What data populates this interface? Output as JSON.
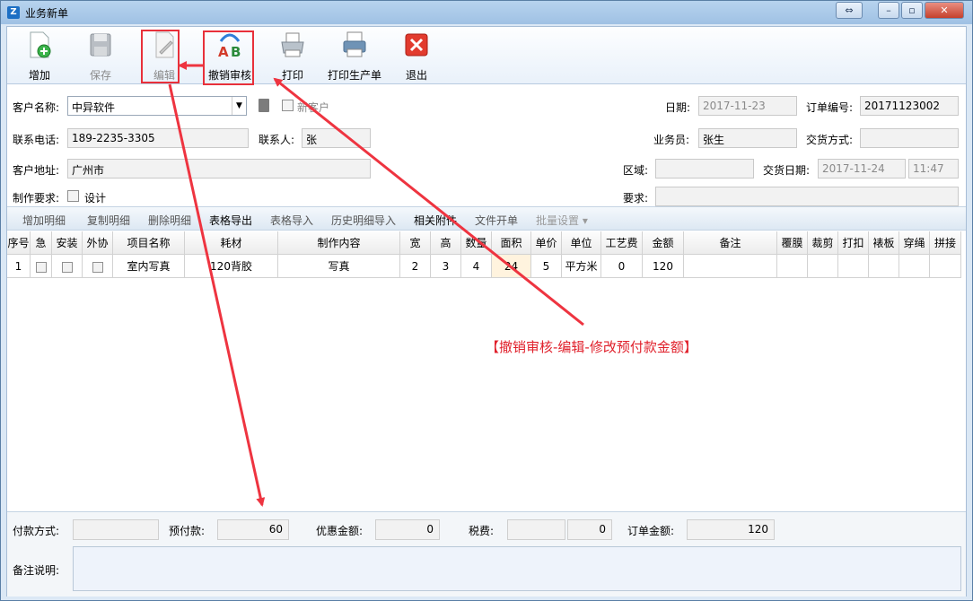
{
  "window": {
    "title": "业务新单"
  },
  "toolbar": {
    "add": "增加",
    "save": "保存",
    "edit": "编辑",
    "unaudit": "撤销审核",
    "print": "打印",
    "print_production": "打印生产单",
    "exit": "退出"
  },
  "form": {
    "customer_label": "客户名称:",
    "customer_value": "中异软件",
    "new_customer_label": "新客户",
    "date_label": "日期:",
    "date_value": "2017-11-23",
    "order_no_label": "订单编号:",
    "order_no_value": "20171123002",
    "phone_label": "联系电话:",
    "phone_value": "189-2235-3305",
    "contact_label": "联系人:",
    "contact_value": "张",
    "salesman_label": "业务员:",
    "salesman_value": "张生",
    "delivery_method_label": "交货方式:",
    "delivery_method_value": "",
    "address_label": "客户地址:",
    "address_value": "广州市",
    "region_label": "区域:",
    "region_value": "",
    "delivery_date_label": "交货日期:",
    "delivery_date_value": "2017-11-24",
    "delivery_time_value": "11:47",
    "requirement_label": "制作要求:",
    "design_label": "设计",
    "request_label": "要求:",
    "request_value": ""
  },
  "subtoolbar": [
    "增加明细",
    "复制明细",
    "删除明细",
    "表格导出",
    "表格导入",
    "历史明细导入",
    "相关附件",
    "文件开单",
    "批量设置"
  ],
  "table": {
    "headers": [
      "序号",
      "急",
      "安装",
      "外协",
      "项目名称",
      "耗材",
      "制作内容",
      "宽",
      "高",
      "数量",
      "面积",
      "单价",
      "单位",
      "工艺费",
      "金额",
      "备注",
      "覆膜",
      "裁剪",
      "打扣",
      "裱板",
      "穿绳",
      "拼接"
    ],
    "rows": [
      [
        "1",
        "",
        "",
        "",
        "室内写真",
        "120背胶",
        "写真",
        "2",
        "3",
        "4",
        "24",
        "5",
        "平方米",
        "0",
        "120",
        "",
        "",
        "",
        "",
        "",
        "",
        ""
      ]
    ]
  },
  "bottom": {
    "payment_method_label": "付款方式:",
    "payment_method_value": "",
    "prepayment_label": "预付款:",
    "prepayment_value": "60",
    "discount_label": "优惠金额:",
    "discount_value": "0",
    "tax_label": "税费:",
    "tax_value": "0",
    "order_amount_label": "订单金额:",
    "order_amount_value": "120",
    "memo_label": "备注说明:"
  },
  "annotation": "【撤销审核-编辑-修改预付款金额】",
  "colors": {
    "annotation": "#e0202b",
    "toolbar_bg": "#e9f1fa"
  }
}
